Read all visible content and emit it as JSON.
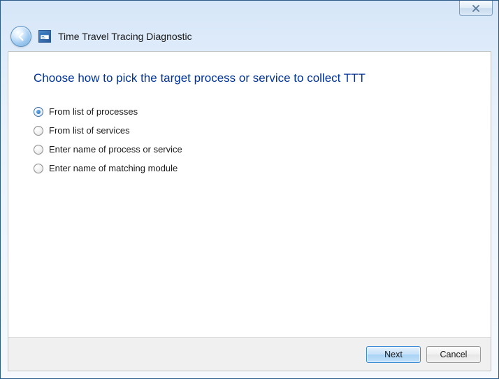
{
  "window": {
    "title": "Time Travel Tracing Diagnostic"
  },
  "page": {
    "heading": "Choose how to pick the target process or service to collect TTT"
  },
  "options": {
    "opt0": {
      "label": "From list of processes",
      "selected": true
    },
    "opt1": {
      "label": "From list of services",
      "selected": false
    },
    "opt2": {
      "label": "Enter name of process or service",
      "selected": false
    },
    "opt3": {
      "label": "Enter name of matching module",
      "selected": false
    }
  },
  "buttons": {
    "next": "Next",
    "cancel": "Cancel"
  }
}
